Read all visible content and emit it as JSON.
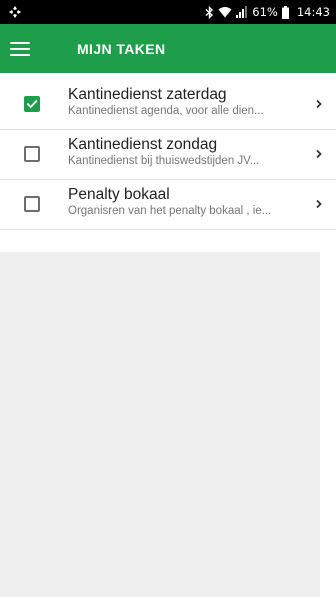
{
  "status_bar": {
    "battery_percent": "61%",
    "time": "14:43",
    "icons": [
      "app-notification-icon",
      "bluetooth-icon",
      "wifi-icon",
      "signal-icon",
      "battery-icon"
    ]
  },
  "app_bar": {
    "title": "MIJN TAKEN",
    "menu_icon": "hamburger-menu-icon"
  },
  "tasks": [
    {
      "title": "Kantinedienst zaterdag",
      "subtitle": "Kantinedienst agenda, voor alle dien...",
      "checked": true
    },
    {
      "title": "Kantinedienst zondag",
      "subtitle": "Kantinedienst bij thuiswedstijden JV...",
      "checked": false
    },
    {
      "title": "Penalty bokaal",
      "subtitle": "Organisren van het penalty bokaal , ie...",
      "checked": false
    }
  ],
  "colors": {
    "primary": "#1e9e4a",
    "status_bar": "#000000",
    "empty_background": "#efefef"
  }
}
